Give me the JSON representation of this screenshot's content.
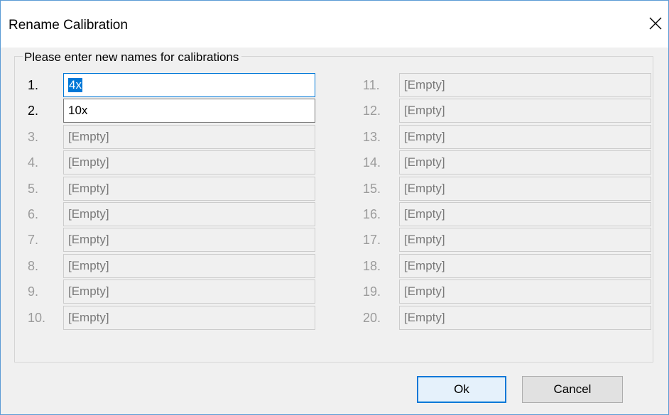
{
  "dialog": {
    "title": "Rename Calibration",
    "group_label": "Please enter new names for calibrations",
    "ok_label": "Ok",
    "cancel_label": "Cancel"
  },
  "calibrations": [
    {
      "number": "1.",
      "value": "4x",
      "enabled": true,
      "selected": true
    },
    {
      "number": "2.",
      "value": "10x",
      "enabled": true
    },
    {
      "number": "3.",
      "value": "[Empty]",
      "enabled": false
    },
    {
      "number": "4.",
      "value": "[Empty]",
      "enabled": false
    },
    {
      "number": "5.",
      "value": "[Empty]",
      "enabled": false
    },
    {
      "number": "6.",
      "value": "[Empty]",
      "enabled": false
    },
    {
      "number": "7.",
      "value": "[Empty]",
      "enabled": false
    },
    {
      "number": "8.",
      "value": "[Empty]",
      "enabled": false
    },
    {
      "number": "9.",
      "value": "[Empty]",
      "enabled": false
    },
    {
      "number": "10.",
      "value": "[Empty]",
      "enabled": false
    },
    {
      "number": "11.",
      "value": "[Empty]",
      "enabled": false
    },
    {
      "number": "12.",
      "value": "[Empty]",
      "enabled": false
    },
    {
      "number": "13.",
      "value": "[Empty]",
      "enabled": false
    },
    {
      "number": "14.",
      "value": "[Empty]",
      "enabled": false
    },
    {
      "number": "15.",
      "value": "[Empty]",
      "enabled": false
    },
    {
      "number": "16.",
      "value": "[Empty]",
      "enabled": false
    },
    {
      "number": "17.",
      "value": "[Empty]",
      "enabled": false
    },
    {
      "number": "18.",
      "value": "[Empty]",
      "enabled": false
    },
    {
      "number": "19.",
      "value": "[Empty]",
      "enabled": false
    },
    {
      "number": "20.",
      "value": "[Empty]",
      "enabled": false
    }
  ],
  "colors": {
    "accent": "#0078d7",
    "disabled_text": "#9b9b9b",
    "dialog_background": "#f0f0f0"
  },
  "icons": {
    "close": "close-icon"
  }
}
